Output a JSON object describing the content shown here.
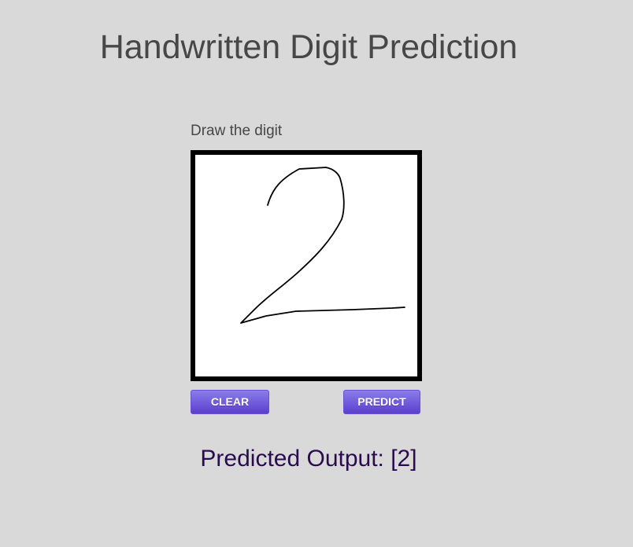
{
  "page": {
    "title": "Handwritten Digit Prediction"
  },
  "canvas": {
    "label": "Draw the digit",
    "drawn_digit": "2"
  },
  "buttons": {
    "clear_label": "CLEAR",
    "predict_label": "PREDICT"
  },
  "result": {
    "text": "Predicted Output: [2]"
  },
  "colors": {
    "background": "#d9d9d9",
    "title_text": "#474747",
    "button_gradient_top": "#8a7de8",
    "button_gradient_bottom": "#5b3fd0",
    "result_text": "#2a0b4e",
    "canvas_border": "#000000",
    "stroke": "#000000"
  }
}
